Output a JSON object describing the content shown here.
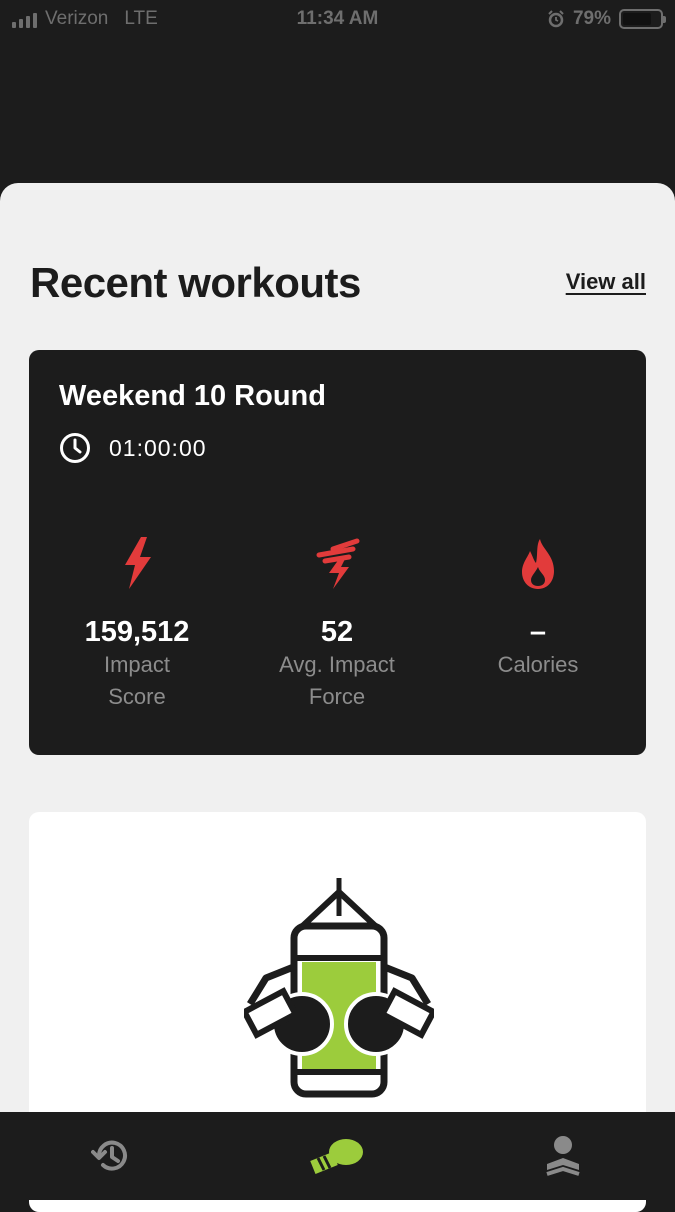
{
  "status_bar": {
    "carrier": "Verizon",
    "network": "LTE",
    "time": "11:34 AM",
    "battery": "79%",
    "battery_level": 0.79
  },
  "recent_workouts": {
    "title": "Recent workouts",
    "view_all_label": "View all"
  },
  "workout": {
    "name": "Weekend 10 Round",
    "duration": "01:00:00",
    "stats": [
      {
        "icon": "lightning-bolt-icon",
        "value": "159,512",
        "label_line1": "Impact",
        "label_line2": "Score"
      },
      {
        "icon": "fast-lightning-icon",
        "value": "52",
        "label_line1": "Avg. Impact",
        "label_line2": "Force"
      },
      {
        "icon": "flame-icon",
        "value": "–",
        "label_line1": "Calories",
        "label_line2": ""
      }
    ]
  },
  "tab_bar": {
    "tabs": [
      {
        "icon": "history-icon",
        "active": false
      },
      {
        "icon": "boxing-glove-icon",
        "active": true
      },
      {
        "icon": "profile-icon",
        "active": false
      }
    ]
  },
  "colors": {
    "accent_red": "#e23b3b",
    "accent_green": "#9ccc3c",
    "dark": "#1c1c1c",
    "sheet_bg": "#f0f0f0",
    "inactive_icon": "#8a8a8a"
  }
}
